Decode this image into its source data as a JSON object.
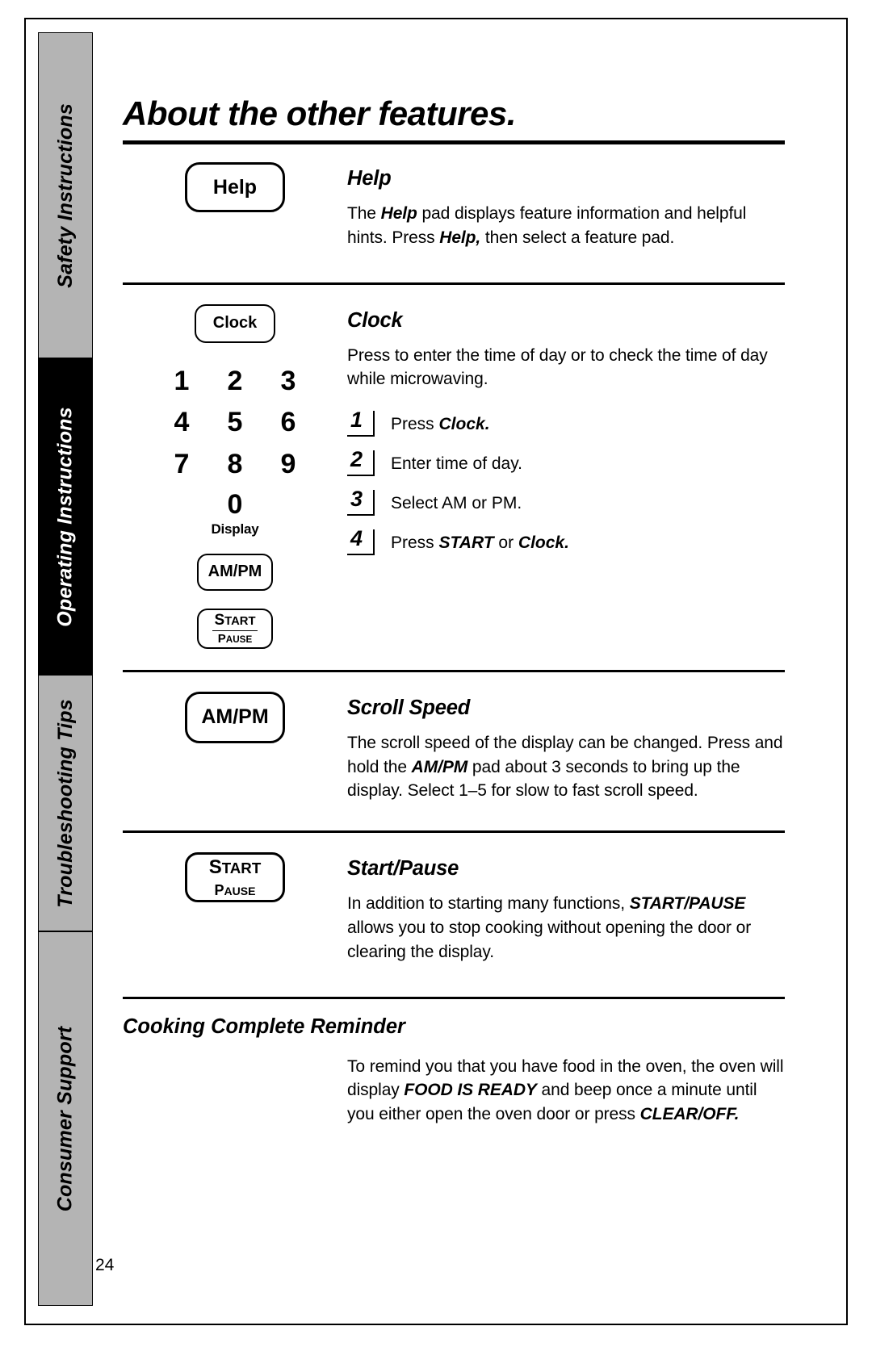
{
  "page": {
    "title": "About the other features.",
    "number": "24"
  },
  "side_tabs": [
    {
      "label": "Safety Instructions",
      "style": "gray"
    },
    {
      "label": "Operating Instructions",
      "style": "black"
    },
    {
      "label": "Troubleshooting Tips",
      "style": "gray"
    },
    {
      "label": "Consumer Support",
      "style": "gray"
    }
  ],
  "sections": [
    {
      "id": "help",
      "heading": "Help",
      "pad_label": "Help",
      "body_parts": [
        {
          "text": "The ",
          "bold": false
        },
        {
          "text": "Help",
          "bold": true
        },
        {
          "text": " pad displays feature information and helpful hints. Press ",
          "bold": false
        },
        {
          "text": "Help,",
          "bold": true
        },
        {
          "text": " then select a feature pad.",
          "bold": false
        }
      ]
    },
    {
      "id": "clock",
      "heading": "Clock",
      "pad_label": "Clock",
      "body_parts": [
        {
          "text": "Press to enter the time of day or to check the time of day while microwaving.",
          "bold": false
        }
      ],
      "keypad": {
        "keys": [
          "1",
          "2",
          "3",
          "4",
          "5",
          "6",
          "7",
          "8",
          "9"
        ],
        "zero": "0",
        "display_label": "Display",
        "ampm_pad": "AM/PM",
        "start_pad_top": "START",
        "start_pad_bottom": "PAUSE"
      },
      "steps": [
        {
          "number": "1",
          "parts": [
            {
              "text": "Press ",
              "bold": false
            },
            {
              "text": "Clock.",
              "bold": true
            }
          ]
        },
        {
          "number": "2",
          "parts": [
            {
              "text": "Enter time of day.",
              "bold": false
            }
          ]
        },
        {
          "number": "3",
          "parts": [
            {
              "text": "Select AM or PM.",
              "bold": false
            }
          ]
        },
        {
          "number": "4",
          "parts": [
            {
              "text": "Press ",
              "bold": false
            },
            {
              "text": "START",
              "bold": true
            },
            {
              "text": " or ",
              "bold": false
            },
            {
              "text": "Clock.",
              "bold": true
            }
          ]
        }
      ]
    },
    {
      "id": "scroll-speed",
      "heading": "Scroll Speed",
      "pad_label": "AM/PM",
      "body_parts": [
        {
          "text": "The scroll speed of the display can be changed. Press and hold the ",
          "bold": false
        },
        {
          "text": "AM/PM",
          "bold": true
        },
        {
          "text": " pad about 3 seconds to bring up the display. Select 1–5 for slow to fast scroll speed.",
          "bold": false
        }
      ]
    },
    {
      "id": "start-pause",
      "heading": "Start/Pause",
      "pad_top": "START",
      "pad_bottom": "PAUSE",
      "body_parts": [
        {
          "text": "In addition to starting many functions, ",
          "bold": false
        },
        {
          "text": "START/PAUSE",
          "bold": true
        },
        {
          "text": " allows you to stop cooking without opening the door or clearing the display.",
          "bold": false
        }
      ]
    },
    {
      "id": "cooking-complete-reminder",
      "heading": "Cooking Complete Reminder",
      "body_parts": [
        {
          "text": "To remind you that you have food in the oven, the oven will display ",
          "bold": false
        },
        {
          "text": "FOOD IS READY",
          "bold": true
        },
        {
          "text": " and beep once a minute until you either open the oven door or press ",
          "bold": false
        },
        {
          "text": "CLEAR/OFF.",
          "bold": true
        }
      ]
    }
  ]
}
